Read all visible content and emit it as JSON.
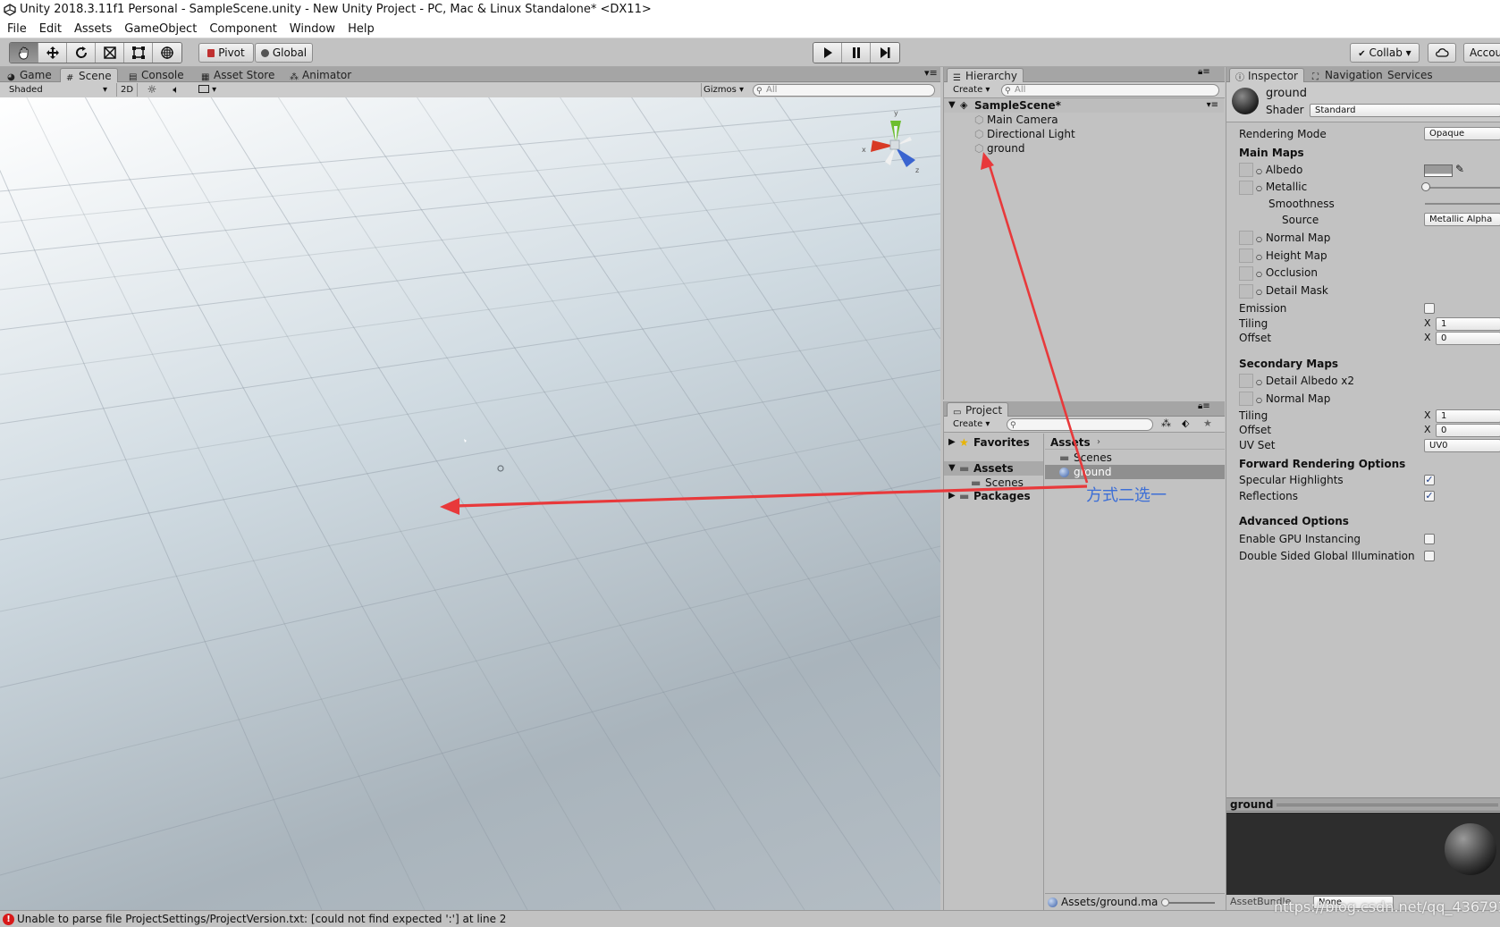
{
  "window": {
    "title": "Unity 2018.3.11f1 Personal - SampleScene.unity - New Unity Project - PC, Mac & Linux Standalone* <DX11>"
  },
  "menu": [
    "File",
    "Edit",
    "Assets",
    "GameObject",
    "Component",
    "Window",
    "Help"
  ],
  "toolbar": {
    "pivot_label": "Pivot",
    "global_label": "Global",
    "collab_label": "Collab ▾",
    "account_label": "Accou"
  },
  "scene_tabs": {
    "game": "Game",
    "scene": "Scene",
    "console": "Console",
    "asset_store": "Asset Store",
    "animator": "Animator"
  },
  "scene_bar": {
    "shading": "Shaded",
    "mode_2d": "2D",
    "gizmos": "Gizmos ▾",
    "search_placeholder": "All"
  },
  "gizmo": {
    "y": "y",
    "x": "x",
    "z": "z"
  },
  "hierarchy": {
    "tab": "Hierarchy",
    "create": "Create ▾",
    "search_placeholder": "All",
    "scene_name": "SampleScene*",
    "items": [
      "Main Camera",
      "Directional Light",
      "ground"
    ]
  },
  "project": {
    "tab": "Project",
    "create": "Create ▾",
    "tree": {
      "favorites": "Favorites",
      "assets": "Assets",
      "scenes": "Scenes",
      "packages": "Packages"
    },
    "breadcrumb": "Assets",
    "files": [
      "Scenes",
      "ground"
    ],
    "footer_path": "Assets/ground.ma"
  },
  "annotation": {
    "text": "方式二选一",
    "color": "#e8393b",
    "text_color": "#3d6fd6"
  },
  "inspector": {
    "tabs": {
      "inspector": "Inspector",
      "navigation": "Navigation",
      "services": "Services"
    },
    "object_name": "ground",
    "shader_label": "Shader",
    "shader_value": "Standard",
    "rendering_mode_label": "Rendering Mode",
    "rendering_mode_value": "Opaque",
    "main_maps": "Main Maps",
    "albedo": "Albedo",
    "metallic": "Metallic",
    "smoothness": "Smoothness",
    "source": "Source",
    "source_value": "Metallic Alpha",
    "normal_map": "Normal Map",
    "height_map": "Height Map",
    "occlusion": "Occlusion",
    "detail_mask": "Detail Mask",
    "emission": "Emission",
    "tiling": "Tiling",
    "offset": "Offset",
    "x": "X",
    "tiling_x": "1",
    "offset_x": "0",
    "secondary_maps": "Secondary Maps",
    "detail_albedo": "Detail Albedo x2",
    "normal_map_2": "Normal Map",
    "tiling_2": "Tiling",
    "offset_2": "Offset",
    "tiling_2_x": "1",
    "offset_2_x": "0",
    "uv_set": "UV Set",
    "uv_set_value": "UV0",
    "forward_options": "Forward Rendering Options",
    "specular_highlights": "Specular Highlights",
    "reflections": "Reflections",
    "advanced_options": "Advanced Options",
    "gpu_instancing": "Enable GPU Instancing",
    "double_sided_gi": "Double Sided Global Illumination",
    "preview_title": "ground",
    "assetbundle_label": "AssetBundle",
    "assetbundle_value": "None"
  },
  "status": {
    "error": "Unable to parse file ProjectSettings/ProjectVersion.txt: [could not find expected ':'] at line 2"
  },
  "watermark": "https://blog.csdn.net/qq_43679333"
}
